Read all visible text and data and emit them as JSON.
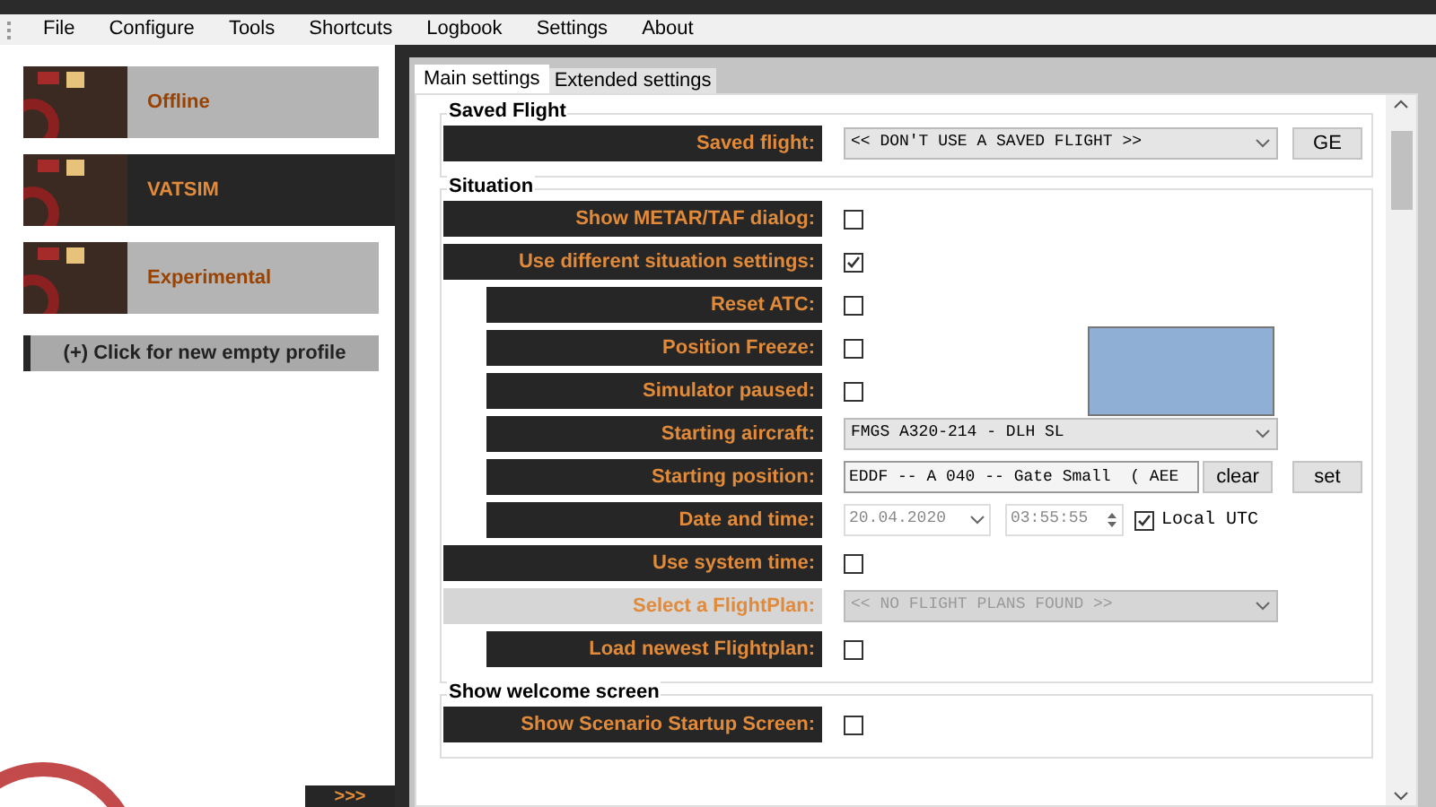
{
  "menu": [
    "File",
    "Configure",
    "Tools",
    "Shortcuts",
    "Logbook",
    "Settings",
    "About"
  ],
  "profiles": [
    {
      "name": "Offline",
      "selected": false
    },
    {
      "name": "VATSIM",
      "selected": true
    },
    {
      "name": "Experimental",
      "selected": false
    }
  ],
  "new_profile_button": "(+) Click for new empty profile",
  "expand_button": ">>>",
  "tabs": [
    {
      "label": "Main settings",
      "selected": true
    },
    {
      "label": "Extended settings",
      "selected": false
    }
  ],
  "groups": [
    {
      "title": "Saved Flight",
      "rows": [
        {
          "kind": "select",
          "label": "Saved flight:",
          "indent": false,
          "disabled": false,
          "value": "<< DON'T USE A SAVED FLIGHT >>",
          "buttons": [
            "GE"
          ]
        }
      ]
    },
    {
      "title": "Situation",
      "rows": [
        {
          "kind": "checkbox",
          "label": "Show METAR/TAF dialog:",
          "indent": false,
          "disabled": false,
          "checked": false
        },
        {
          "kind": "checkbox",
          "label": "Use different situation settings:",
          "indent": false,
          "disabled": false,
          "checked": true
        },
        {
          "kind": "checkbox",
          "label": "Reset ATC:",
          "indent": true,
          "disabled": false,
          "checked": false
        },
        {
          "kind": "checkbox",
          "label": "Position Freeze:",
          "indent": true,
          "disabled": false,
          "checked": false
        },
        {
          "kind": "checkbox",
          "label": "Simulator paused:",
          "indent": true,
          "disabled": false,
          "checked": false
        },
        {
          "kind": "select",
          "label": "Starting aircraft:",
          "indent": true,
          "disabled": false,
          "value": "FMGS A320-214 - DLH SL"
        },
        {
          "kind": "text",
          "label": "Starting position:",
          "indent": true,
          "disabled": false,
          "value": "EDDF -- A 040 -- Gate Small  ( AEE",
          "buttons": [
            "clear",
            "set"
          ]
        },
        {
          "kind": "datetime",
          "label": "Date and time:",
          "indent": true,
          "disabled": false,
          "date": "20.04.2020",
          "time": "03:55:55",
          "utc_label": "Local UTC",
          "utc_checked": true
        },
        {
          "kind": "checkbox",
          "label": "Use system time:",
          "indent": false,
          "disabled": false,
          "checked": false
        },
        {
          "kind": "select",
          "label": "Select a FlightPlan:",
          "indent": false,
          "disabled": true,
          "value": "<< NO FLIGHT PLANS FOUND >>"
        },
        {
          "kind": "checkbox",
          "label": "Load newest Flightplan:",
          "indent": true,
          "disabled": false,
          "checked": false
        }
      ]
    },
    {
      "title": "Show welcome screen",
      "rows": [
        {
          "kind": "checkbox",
          "label": "Show Scenario Startup Screen:",
          "indent": false,
          "disabled": false,
          "checked": false
        }
      ]
    }
  ]
}
